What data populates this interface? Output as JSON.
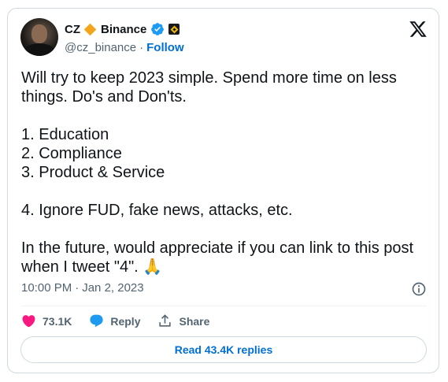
{
  "author": {
    "display_name": "CZ",
    "affiliation": "Binance",
    "handle": "@cz_binance",
    "separator": "·",
    "follow_label": "Follow",
    "icons": [
      "diamond-icon",
      "verified-icon",
      "binance-badge-icon"
    ]
  },
  "tweet": {
    "text": "Will try to keep 2023 simple. Spend more time on less\nthings. Do's and Don'ts.\n\n1. Education\n2. Compliance\n3. Product & Service\n\n4. Ignore FUD, fake news, attacks, etc.\n\nIn the future, would appreciate if you can link to this post\nwhen I tweet \"4\". 🙏",
    "time": "10:00 PM",
    "separator": "·",
    "date": "Jan 2, 2023"
  },
  "actions": {
    "likes": "73.1K",
    "reply_label": "Reply",
    "share_label": "Share"
  },
  "read_replies_label": "Read 43.4K replies",
  "colors": {
    "accent": "#006fd6",
    "like": "#f91880",
    "verified": "#1d9bf0",
    "diamond": "#f3a61b",
    "binance": "#f0b90b"
  }
}
